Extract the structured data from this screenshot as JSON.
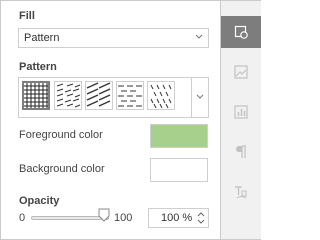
{
  "fill": {
    "heading": "Fill",
    "selected": "Pattern"
  },
  "pattern": {
    "heading": "Pattern",
    "items": [
      "grid-pattern-icon",
      "diagonal-dash-pattern-icon",
      "wide-diagonal-pattern-icon",
      "horizontal-dash-pattern-icon",
      "diagonal-dots-pattern-icon"
    ],
    "selected_index": 0
  },
  "foreground": {
    "label": "Foreground color",
    "color": "#a7d08c"
  },
  "background": {
    "label": "Background color",
    "color": "#ffffff"
  },
  "opacity": {
    "heading": "Opacity",
    "min_label": "0",
    "max_label": "100",
    "value": "100 %",
    "level": 1.0
  },
  "sidebar": {
    "tabs": [
      "shape-settings-icon",
      "image-settings-icon",
      "chart-settings-icon",
      "paragraph-settings-icon",
      "text-art-settings-icon"
    ],
    "active_index": 0
  },
  "colors": {
    "active_tab_bg": "#7d7d7d",
    "sidebar_bg": "#f1f1f1",
    "border": "#cbcbcb"
  }
}
